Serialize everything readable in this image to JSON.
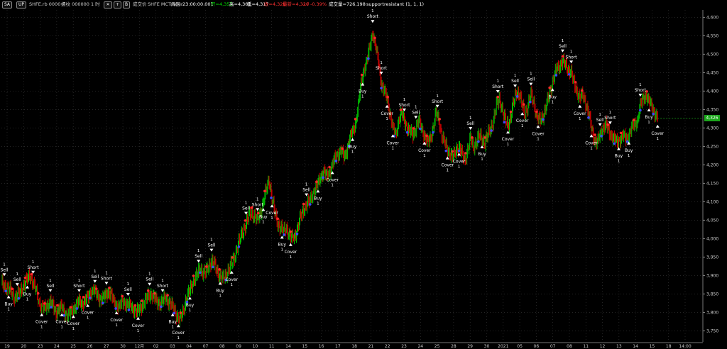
{
  "toolbar": {
    "sa_btn": "SA",
    "up_btn": "UP",
    "symbol": "SHFE.rb 0000",
    "name_interval": "螺纹 000000  1 时",
    "cross_icon": "cross-icon",
    "plus_btn": "+",
    "bar_btn": "B",
    "trade_label": "成交价",
    "source": "SHFE  MCTrader",
    "period_label": "周回",
    "datetime": "23:00:00.001",
    "open": "开=4,353",
    "high": "高=4,361",
    "low": "低=4,317",
    "close": "收=4,326",
    "last": "最新=4,326",
    "change": "-17",
    "change_pct": "-0.39%",
    "volume": "成交量=726,198",
    "study": "supportresistant  (1,  1,  1)"
  },
  "price_tag": "4,326",
  "colors": {
    "up": "#00d000",
    "down": "#e00000",
    "red_dot": "#ff2a2a",
    "blue_dot": "#3a4cff",
    "grid": "#3a3a3a",
    "signal": "#ffffff",
    "price_tag_bg": "#1ba51b"
  },
  "chart_data": {
    "type": "candlestick",
    "ylim": [
      3720,
      4620
    ],
    "y_ticks": [
      "3,750",
      "3,800",
      "3,850",
      "3,900",
      "3,950",
      "4,000",
      "4,050",
      "4,100",
      "4,150",
      "4,200",
      "4,250",
      "4,300",
      "4,350",
      "4,400",
      "4,450",
      "4,500",
      "4,550",
      "4,600"
    ],
    "x_ticks": [
      "19",
      "20",
      "23",
      "24",
      "25",
      "26",
      "27",
      "30",
      "12月",
      "02",
      "03",
      "04",
      "07",
      "08",
      "09",
      "10",
      "11",
      "14",
      "15",
      "16",
      "17",
      "18",
      "21",
      "22",
      "23",
      "24",
      "25",
      "28",
      "29",
      "30",
      "2021",
      "05",
      "06",
      "07",
      "08",
      "11",
      "12",
      "13",
      "14",
      "15",
      "18",
      "14:00"
    ],
    "close_path": [
      [
        0,
        3880
      ],
      [
        6,
        3870
      ],
      [
        12,
        3860
      ],
      [
        18,
        3840
      ],
      [
        24,
        3850
      ],
      [
        30,
        3870
      ],
      [
        36,
        3890
      ],
      [
        40,
        3900
      ],
      [
        44,
        3880
      ],
      [
        48,
        3860
      ],
      [
        52,
        3830
      ],
      [
        56,
        3815
      ],
      [
        60,
        3810
      ],
      [
        64,
        3820
      ],
      [
        68,
        3830
      ],
      [
        72,
        3815
      ],
      [
        76,
        3800
      ],
      [
        80,
        3810
      ],
      [
        84,
        3815
      ],
      [
        88,
        3800
      ],
      [
        92,
        3790
      ],
      [
        96,
        3800
      ],
      [
        100,
        3810
      ],
      [
        104,
        3820
      ],
      [
        108,
        3830
      ],
      [
        112,
        3825
      ],
      [
        116,
        3830
      ],
      [
        120,
        3840
      ],
      [
        124,
        3855
      ],
      [
        128,
        3860
      ],
      [
        132,
        3850
      ],
      [
        136,
        3840
      ],
      [
        140,
        3835
      ],
      [
        144,
        3845
      ],
      [
        148,
        3855
      ],
      [
        152,
        3850
      ],
      [
        156,
        3830
      ],
      [
        160,
        3820
      ],
      [
        164,
        3815
      ],
      [
        168,
        3830
      ],
      [
        172,
        3825
      ],
      [
        176,
        3820
      ],
      [
        180,
        3815
      ],
      [
        184,
        3810
      ],
      [
        188,
        3800
      ],
      [
        192,
        3810
      ],
      [
        196,
        3820
      ],
      [
        200,
        3830
      ],
      [
        204,
        3845
      ],
      [
        208,
        3850
      ],
      [
        212,
        3840
      ],
      [
        216,
        3830
      ],
      [
        220,
        3825
      ],
      [
        224,
        3830
      ],
      [
        228,
        3840
      ],
      [
        232,
        3830
      ],
      [
        236,
        3820
      ],
      [
        240,
        3810
      ],
      [
        244,
        3790
      ],
      [
        248,
        3780
      ],
      [
        252,
        3800
      ],
      [
        256,
        3830
      ],
      [
        260,
        3850
      ],
      [
        264,
        3870
      ],
      [
        268,
        3890
      ],
      [
        272,
        3900
      ],
      [
        276,
        3920
      ],
      [
        280,
        3910
      ],
      [
        284,
        3905
      ],
      [
        288,
        3925
      ],
      [
        292,
        3940
      ],
      [
        296,
        3930
      ],
      [
        300,
        3910
      ],
      [
        304,
        3900
      ],
      [
        308,
        3890
      ],
      [
        312,
        3900
      ],
      [
        316,
        3920
      ],
      [
        320,
        3930
      ],
      [
        324,
        3950
      ],
      [
        328,
        3980
      ],
      [
        332,
        4000
      ],
      [
        336,
        4020
      ],
      [
        340,
        4040
      ],
      [
        344,
        4060
      ],
      [
        348,
        4070
      ],
      [
        352,
        4060
      ],
      [
        356,
        4050
      ],
      [
        360,
        4070
      ],
      [
        364,
        4100
      ],
      [
        368,
        4130
      ],
      [
        372,
        4160
      ],
      [
        376,
        4110
      ],
      [
        380,
        4070
      ],
      [
        384,
        4040
      ],
      [
        388,
        4030
      ],
      [
        392,
        4020
      ],
      [
        396,
        4030
      ],
      [
        400,
        4010
      ],
      [
        404,
        4000
      ],
      [
        408,
        4010
      ],
      [
        412,
        4030
      ],
      [
        416,
        4060
      ],
      [
        420,
        4080
      ],
      [
        424,
        4090
      ],
      [
        428,
        4100
      ],
      [
        432,
        4120
      ],
      [
        436,
        4130
      ],
      [
        440,
        4150
      ],
      [
        444,
        4170
      ],
      [
        448,
        4180
      ],
      [
        452,
        4170
      ],
      [
        456,
        4180
      ],
      [
        460,
        4200
      ],
      [
        464,
        4220
      ],
      [
        468,
        4230
      ],
      [
        472,
        4240
      ],
      [
        476,
        4220
      ],
      [
        480,
        4240
      ],
      [
        484,
        4270
      ],
      [
        488,
        4290
      ],
      [
        492,
        4310
      ],
      [
        496,
        4360
      ],
      [
        500,
        4420
      ],
      [
        504,
        4460
      ],
      [
        508,
        4480
      ],
      [
        512,
        4520
      ],
      [
        516,
        4560
      ],
      [
        520,
        4520
      ],
      [
        524,
        4480
      ],
      [
        528,
        4420
      ],
      [
        532,
        4400
      ],
      [
        536,
        4380
      ],
      [
        540,
        4340
      ],
      [
        544,
        4300
      ],
      [
        548,
        4280
      ],
      [
        552,
        4320
      ],
      [
        556,
        4340
      ],
      [
        560,
        4320
      ],
      [
        564,
        4300
      ],
      [
        568,
        4290
      ],
      [
        572,
        4280
      ],
      [
        576,
        4300
      ],
      [
        580,
        4320
      ],
      [
        584,
        4300
      ],
      [
        588,
        4280
      ],
      [
        592,
        4260
      ],
      [
        596,
        4270
      ],
      [
        600,
        4300
      ],
      [
        604,
        4340
      ],
      [
        608,
        4320
      ],
      [
        612,
        4280
      ],
      [
        616,
        4260
      ],
      [
        620,
        4240
      ],
      [
        624,
        4230
      ],
      [
        628,
        4220
      ],
      [
        632,
        4240
      ],
      [
        636,
        4250
      ],
      [
        640,
        4230
      ],
      [
        644,
        4210
      ],
      [
        648,
        4240
      ],
      [
        652,
        4270
      ],
      [
        656,
        4250
      ],
      [
        660,
        4260
      ],
      [
        664,
        4280
      ],
      [
        668,
        4270
      ],
      [
        672,
        4260
      ],
      [
        676,
        4280
      ],
      [
        680,
        4300
      ],
      [
        684,
        4320
      ],
      [
        688,
        4360
      ],
      [
        692,
        4380
      ],
      [
        696,
        4350
      ],
      [
        700,
        4320
      ],
      [
        704,
        4310
      ],
      [
        708,
        4330
      ],
      [
        712,
        4370
      ],
      [
        716,
        4400
      ],
      [
        720,
        4390
      ],
      [
        724,
        4360
      ],
      [
        728,
        4340
      ],
      [
        732,
        4360
      ],
      [
        736,
        4390
      ],
      [
        740,
        4370
      ],
      [
        744,
        4330
      ],
      [
        748,
        4320
      ],
      [
        752,
        4330
      ],
      [
        756,
        4350
      ],
      [
        760,
        4380
      ],
      [
        764,
        4410
      ],
      [
        768,
        4440
      ],
      [
        772,
        4460
      ],
      [
        776,
        4470
      ],
      [
        780,
        4480
      ],
      [
        784,
        4470
      ],
      [
        788,
        4460
      ],
      [
        792,
        4450
      ],
      [
        796,
        4420
      ],
      [
        800,
        4400
      ],
      [
        804,
        4380
      ],
      [
        808,
        4390
      ],
      [
        812,
        4370
      ],
      [
        816,
        4340
      ],
      [
        820,
        4300
      ],
      [
        824,
        4270
      ],
      [
        828,
        4260
      ],
      [
        832,
        4280
      ],
      [
        836,
        4300
      ],
      [
        840,
        4310
      ],
      [
        844,
        4290
      ],
      [
        848,
        4280
      ],
      [
        852,
        4270
      ],
      [
        856,
        4260
      ],
      [
        860,
        4270
      ],
      [
        864,
        4280
      ],
      [
        868,
        4270
      ],
      [
        872,
        4280
      ],
      [
        876,
        4300
      ],
      [
        880,
        4310
      ],
      [
        884,
        4320
      ],
      [
        888,
        4360
      ],
      [
        892,
        4380
      ],
      [
        896,
        4390
      ],
      [
        900,
        4370
      ],
      [
        904,
        4360
      ],
      [
        908,
        4340
      ],
      [
        912,
        4326
      ]
    ],
    "signals": [
      {
        "t": 4,
        "label": "Sell",
        "n": "1",
        "side": "above"
      },
      {
        "t": 10,
        "label": "Buy",
        "n": "1",
        "side": "below"
      },
      {
        "t": 22,
        "label": "Sell",
        "n": "1",
        "side": "above"
      },
      {
        "t": 36,
        "label": "Buy",
        "n": "1",
        "side": "below"
      },
      {
        "t": 44,
        "label": "Short",
        "n": "1",
        "side": "above"
      },
      {
        "t": 56,
        "label": "Cover",
        "n": "1",
        "side": "below"
      },
      {
        "t": 68,
        "label": "Sell",
        "n": "1",
        "side": "above"
      },
      {
        "t": 84,
        "label": "Cover",
        "n": "1",
        "side": "below"
      },
      {
        "t": 100,
        "label": "Cover",
        "n": "1",
        "side": "below"
      },
      {
        "t": 108,
        "label": "Short",
        "n": "1",
        "side": "above"
      },
      {
        "t": 120,
        "label": "Cover",
        "n": "1",
        "side": "below"
      },
      {
        "t": 130,
        "label": "Sell",
        "n": "1",
        "side": "above"
      },
      {
        "t": 146,
        "label": "Short",
        "n": "1",
        "side": "above"
      },
      {
        "t": 160,
        "label": "Cover",
        "n": "1",
        "side": "below"
      },
      {
        "t": 176,
        "label": "Sell",
        "n": "1",
        "side": "above"
      },
      {
        "t": 190,
        "label": "Cover",
        "n": "1",
        "side": "below"
      },
      {
        "t": 206,
        "label": "Sell",
        "n": "1",
        "side": "above"
      },
      {
        "t": 224,
        "label": "Short",
        "n": "1",
        "side": "above"
      },
      {
        "t": 238,
        "label": "Buy",
        "n": "1",
        "side": "below"
      },
      {
        "t": 246,
        "label": "Cover",
        "n": "1",
        "side": "below"
      },
      {
        "t": 262,
        "label": "Buy",
        "n": "1",
        "side": "below"
      },
      {
        "t": 274,
        "label": "Sell",
        "n": "1",
        "side": "above"
      },
      {
        "t": 292,
        "label": "Sell",
        "n": "1",
        "side": "above"
      },
      {
        "t": 304,
        "label": "Buy",
        "n": "1",
        "side": "below"
      },
      {
        "t": 320,
        "label": "Cover",
        "n": "1",
        "side": "below"
      },
      {
        "t": 340,
        "label": "Sell",
        "n": "1",
        "side": "above"
      },
      {
        "t": 356,
        "label": "Short",
        "n": "1",
        "side": "above"
      },
      {
        "t": 364,
        "label": "Buy",
        "n": "1",
        "side": "below"
      },
      {
        "t": 376,
        "label": "Cover",
        "n": "1",
        "side": "below"
      },
      {
        "t": 390,
        "label": "Buy",
        "n": "1",
        "side": "below"
      },
      {
        "t": 402,
        "label": "Cover",
        "n": "1",
        "side": "below"
      },
      {
        "t": 424,
        "label": "Sell",
        "n": "1",
        "side": "above"
      },
      {
        "t": 440,
        "label": "Buy",
        "n": "1",
        "side": "below"
      },
      {
        "t": 460,
        "label": "Cover",
        "n": "1",
        "side": "below"
      },
      {
        "t": 488,
        "label": "Buy",
        "n": "1",
        "side": "below"
      },
      {
        "t": 502,
        "label": "Buy",
        "n": "1",
        "side": "below"
      },
      {
        "t": 516,
        "label": "Short",
        "n": "1",
        "side": "above"
      },
      {
        "t": 528,
        "label": "Short",
        "n": "1",
        "side": "above"
      },
      {
        "t": 536,
        "label": "Cover",
        "n": "1",
        "side": "below"
      },
      {
        "t": 544,
        "label": "Cover",
        "n": "1",
        "side": "below"
      },
      {
        "t": 560,
        "label": "Short",
        "n": "1",
        "side": "above"
      },
      {
        "t": 576,
        "label": "Sell",
        "n": "1",
        "side": "above"
      },
      {
        "t": 588,
        "label": "Cover",
        "n": "1",
        "side": "below"
      },
      {
        "t": 606,
        "label": "Short",
        "n": "1",
        "side": "above"
      },
      {
        "t": 620,
        "label": "Cover",
        "n": "1",
        "side": "below"
      },
      {
        "t": 636,
        "label": "Cover",
        "n": "1",
        "side": "below"
      },
      {
        "t": 652,
        "label": "Sell",
        "n": "1",
        "side": "above"
      },
      {
        "t": 668,
        "label": "Buy",
        "n": "1",
        "side": "below"
      },
      {
        "t": 690,
        "label": "Short",
        "n": "1",
        "side": "above"
      },
      {
        "t": 704,
        "label": "Cover",
        "n": "1",
        "side": "below"
      },
      {
        "t": 714,
        "label": "Sell",
        "n": "1",
        "side": "above"
      },
      {
        "t": 724,
        "label": "Cover",
        "n": "1",
        "side": "below"
      },
      {
        "t": 736,
        "label": "Sell",
        "n": "1",
        "side": "above"
      },
      {
        "t": 746,
        "label": "Cover",
        "n": "1",
        "side": "below"
      },
      {
        "t": 766,
        "label": "Buy",
        "n": "1",
        "side": "below"
      },
      {
        "t": 780,
        "label": "Sell",
        "n": "1",
        "side": "above"
      },
      {
        "t": 792,
        "label": "Short",
        "n": "1",
        "side": "above"
      },
      {
        "t": 804,
        "label": "Cover",
        "n": "1",
        "side": "below"
      },
      {
        "t": 820,
        "label": "Cover",
        "n": "1",
        "side": "below"
      },
      {
        "t": 832,
        "label": "Sell",
        "n": "1",
        "side": "above"
      },
      {
        "t": 846,
        "label": "Short",
        "n": "1",
        "side": "above"
      },
      {
        "t": 858,
        "label": "Buy",
        "n": "1",
        "side": "below"
      },
      {
        "t": 872,
        "label": "Buy",
        "n": "1",
        "side": "below"
      },
      {
        "t": 888,
        "label": "Short",
        "n": "1",
        "side": "above"
      },
      {
        "t": 900,
        "label": "Buy",
        "n": "1",
        "side": "below"
      },
      {
        "t": 912,
        "label": "Cover",
        "n": "1",
        "side": "below"
      }
    ]
  }
}
